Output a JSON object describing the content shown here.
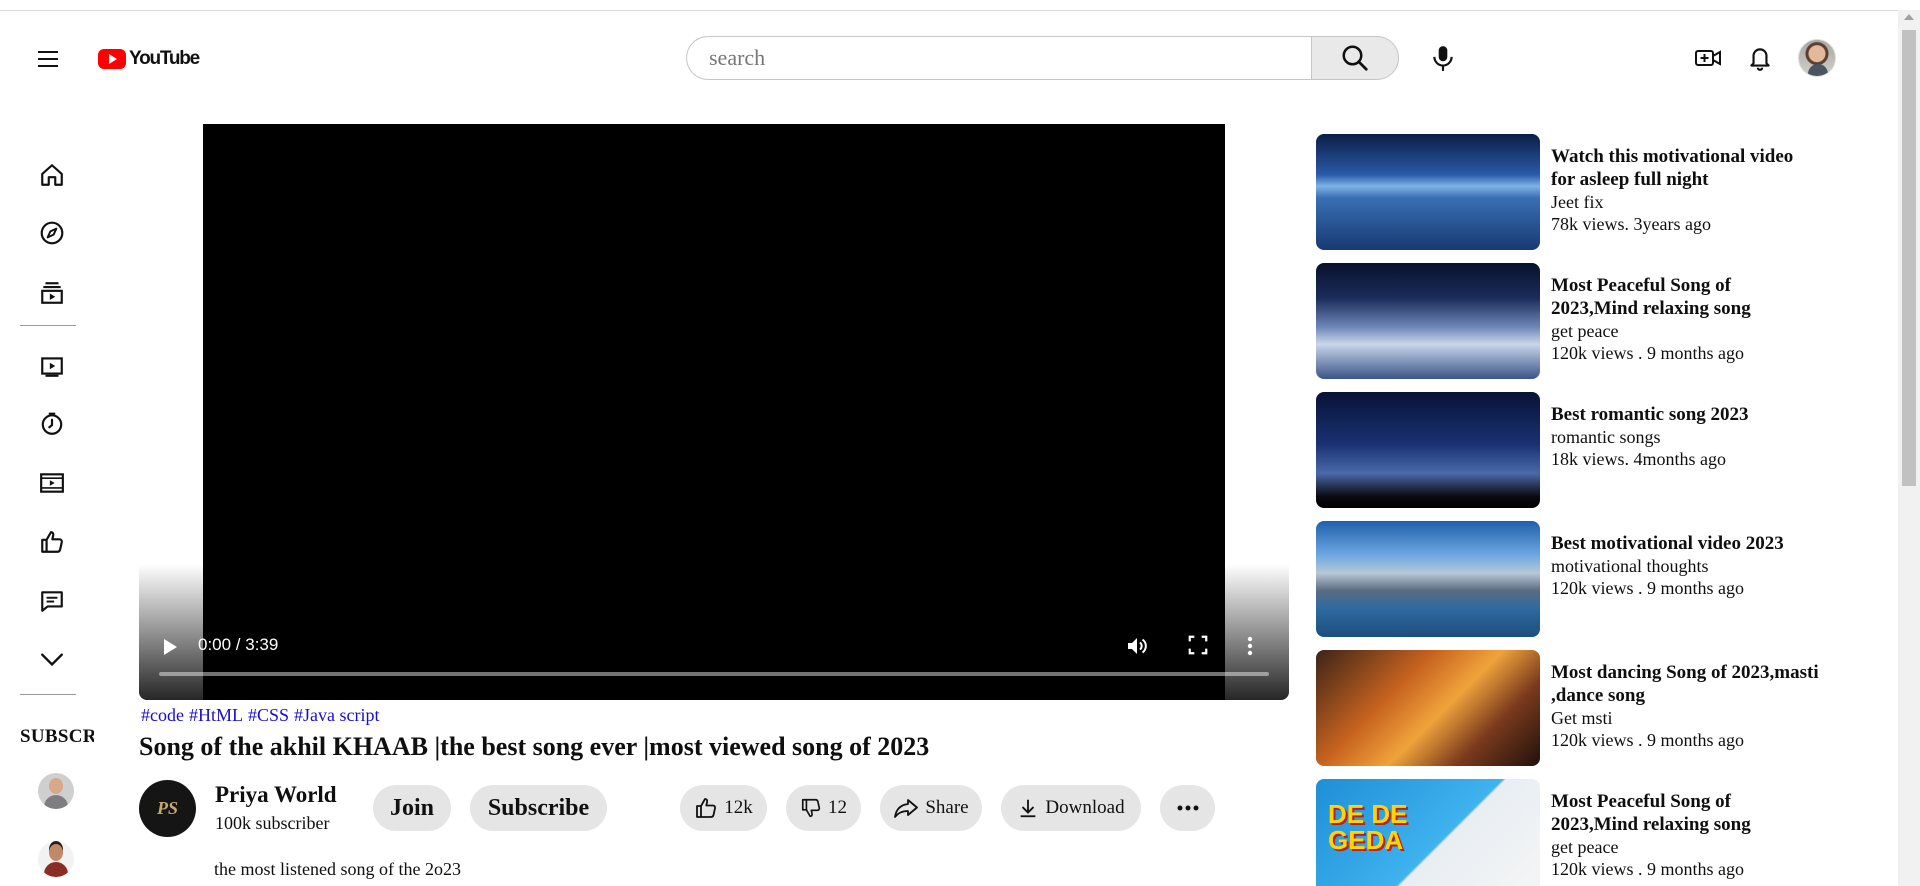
{
  "header": {
    "logo_text": "YouTube",
    "search_placeholder": "search"
  },
  "sidebar": {
    "items": [
      {
        "icon": "home-icon"
      },
      {
        "icon": "explore-icon"
      },
      {
        "icon": "subscriptions-icon"
      },
      {
        "icon": "library-icon"
      },
      {
        "icon": "history-icon"
      },
      {
        "icon": "your-videos-icon"
      },
      {
        "icon": "liked-videos-icon"
      },
      {
        "icon": "comments-icon"
      },
      {
        "icon": "show-more-icon"
      }
    ],
    "subscriptions_label": "SUBSCRIPTIONS"
  },
  "player": {
    "time": "0:00 / 3:39",
    "progress": 0
  },
  "video": {
    "hashtags": [
      "#code",
      "#HtML",
      "#CSS",
      "#Java script"
    ],
    "title": "Song of the akhil KHAAB |the best song ever |most viewed song of 2023",
    "channel_logo_text": "PS",
    "channel_name": "Priya World",
    "channel_subs": "100k subscriber",
    "join_label": "Join",
    "subscribe_label": "Subscribe",
    "likes": "12k",
    "dislikes": "12",
    "share_label": "Share",
    "download_label": "Download",
    "description": "the most listened song of the 2o23"
  },
  "recommendations": [
    {
      "title": "Watch this motivational video for asleep full night",
      "channel": "Jeet fix",
      "meta": "78k views. 3years ago"
    },
    {
      "title": "Most Peaceful Song of 2023,Mind relaxing song",
      "channel": "get peace",
      "meta": "120k views . 9 months ago"
    },
    {
      "title": "Best romantic song 2023",
      "channel": "romantic songs",
      "meta": "18k views. 4months ago"
    },
    {
      "title": "Best motivational video 2023",
      "channel": "motivational thoughts",
      "meta": "120k views . 9 months ago"
    },
    {
      "title": "Most dancing Song of 2023,masti ,dance song",
      "channel": "Get msti",
      "meta": "120k views . 9 months ago"
    },
    {
      "title": "Most Peaceful Song of 2023,Mind relaxing song",
      "channel": "get peace",
      "meta": "120k views . 9 months ago",
      "thumb_text": "DE DE GEDA"
    }
  ]
}
